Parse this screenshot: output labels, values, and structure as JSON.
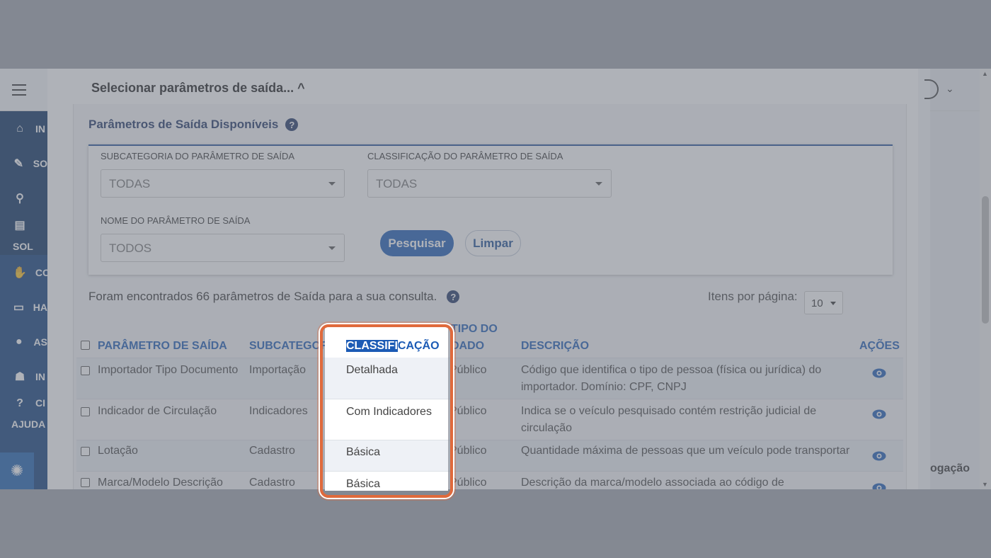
{
  "sidebar": {
    "items": [
      {
        "icon": "home-icon",
        "label": "IN"
      },
      {
        "icon": "edit-icon",
        "label": "SO"
      },
      {
        "icon": "search-icon",
        "label": ""
      },
      {
        "icon": "document-icon",
        "label": "SOL"
      },
      {
        "icon": "handshake-icon",
        "label": "CO"
      },
      {
        "icon": "id-card-icon",
        "label": "HA"
      },
      {
        "icon": "users-icon",
        "label": "AS"
      },
      {
        "icon": "user-shield-icon",
        "label": "IN"
      },
      {
        "icon": "help-icon",
        "label": "CI"
      },
      {
        "icon": "",
        "label": "AJUDA"
      }
    ]
  },
  "right_area": {
    "bottom_text": "ogação"
  },
  "modal": {
    "title": "Selecionar parâmetros de saída...",
    "title_caret": "^",
    "section_title": "Parâmetros de Saída Disponíveis",
    "filters": {
      "subcategoria_label": "SUBCATEGORIA DO PARÂMETRO DE SAÍDA",
      "subcategoria_value": "TODAS",
      "classificacao_label": "CLASSIFICAÇÃO DO PARÂMETRO DE SAÍDA",
      "classificacao_value": "TODAS",
      "nome_label": "NOME DO PARÂMETRO DE SAÍDA",
      "nome_value": "TODOS",
      "search_button": "Pesquisar",
      "clear_button": "Limpar"
    },
    "result_text": "Foram encontrados 66 parâmetros de Saída para a sua consulta.",
    "per_page_label": "Itens por página:",
    "per_page_value": "10",
    "table": {
      "headers": {
        "parametro": "PARÂMETRO DE SAÍDA",
        "subcategoria": "SUBCATEGORIA",
        "classificacao_sel": "CLASSIFI",
        "classificacao_rest": "CAÇÃO",
        "tipo_line1": "TIPO DO",
        "tipo_line2": "DADO",
        "descricao": "DESCRIÇÃO",
        "acoes": "AÇÕES"
      },
      "rows": [
        {
          "parametro": "Importador Tipo Documento",
          "subcategoria": "Importação",
          "classificacao": "Detalhada",
          "tipo": "Público",
          "descricao_1": "Código que identifica o tipo de pessoa (física ou jurídica) do",
          "descricao_2": "importador. Domínio: CPF, CNPJ"
        },
        {
          "parametro": "Indicador de Circulação",
          "subcategoria": "Indicadores",
          "classificacao": "Com Indicadores",
          "tipo": "Público",
          "descricao_1": "Indica se o veículo pesquisado contém restrição judicial de",
          "descricao_2": "circulação"
        },
        {
          "parametro": "Lotação",
          "subcategoria": "Cadastro",
          "classificacao": "Básica",
          "tipo": "Público",
          "descricao_1": "Quantidade máxima de pessoas que um veículo pode transportar",
          "descricao_2": ""
        },
        {
          "parametro": "Marca/Modelo Descrição",
          "subcategoria": "Cadastro",
          "classificacao": "Básica",
          "tipo": "Público",
          "descricao_1": "Descrição da marca/modelo associada ao código de",
          "descricao_2": ""
        }
      ]
    }
  },
  "colors": {
    "primary": "#1c5bb5",
    "highlight": "#e06a3c",
    "heading": "#1f3566"
  }
}
